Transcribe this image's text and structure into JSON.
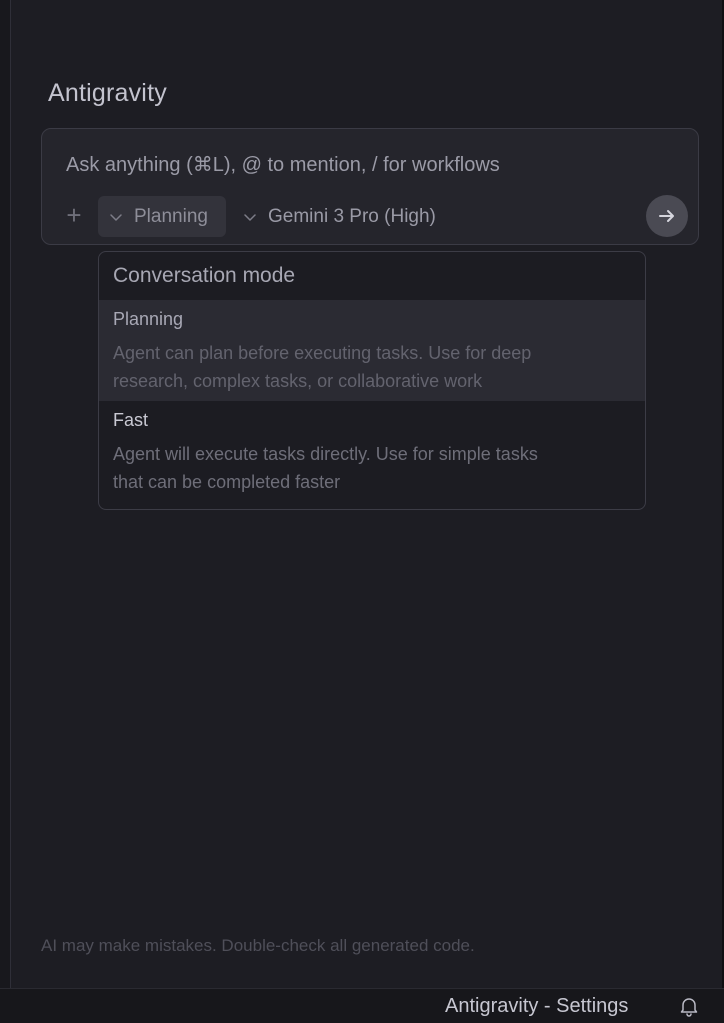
{
  "panel": {
    "title": "Antigravity"
  },
  "composer": {
    "placeholder": "Ask anything (⌘L), @ to mention, / for workflows",
    "mode_label": "Planning",
    "model_label": "Gemini 3 Pro (High)",
    "add_icon": "plus-icon",
    "send_icon": "arrow-right-icon"
  },
  "dropdown": {
    "header": "Conversation mode",
    "options": [
      {
        "title": "Planning",
        "description_line1": "Agent can plan before executing tasks. Use for deep",
        "description_line2": "research, complex tasks, or collaborative work",
        "selected": true
      },
      {
        "title": "Fast",
        "description_line1": "Agent will execute tasks directly. Use for simple tasks",
        "description_line2": "that can be completed faster",
        "selected": false
      }
    ]
  },
  "footer": {
    "disclaimer": "AI may make mistakes. Double-check all generated code."
  },
  "status_bar": {
    "label": "Antigravity - Settings",
    "bell_icon": "bell-icon"
  },
  "colors": {
    "background": "#1d1d23",
    "composer_bg": "#25252c",
    "dropdown_bg": "#1c1c22",
    "selected_option_bg": "#2b2b33",
    "send_button_bg": "#4a4a53"
  }
}
